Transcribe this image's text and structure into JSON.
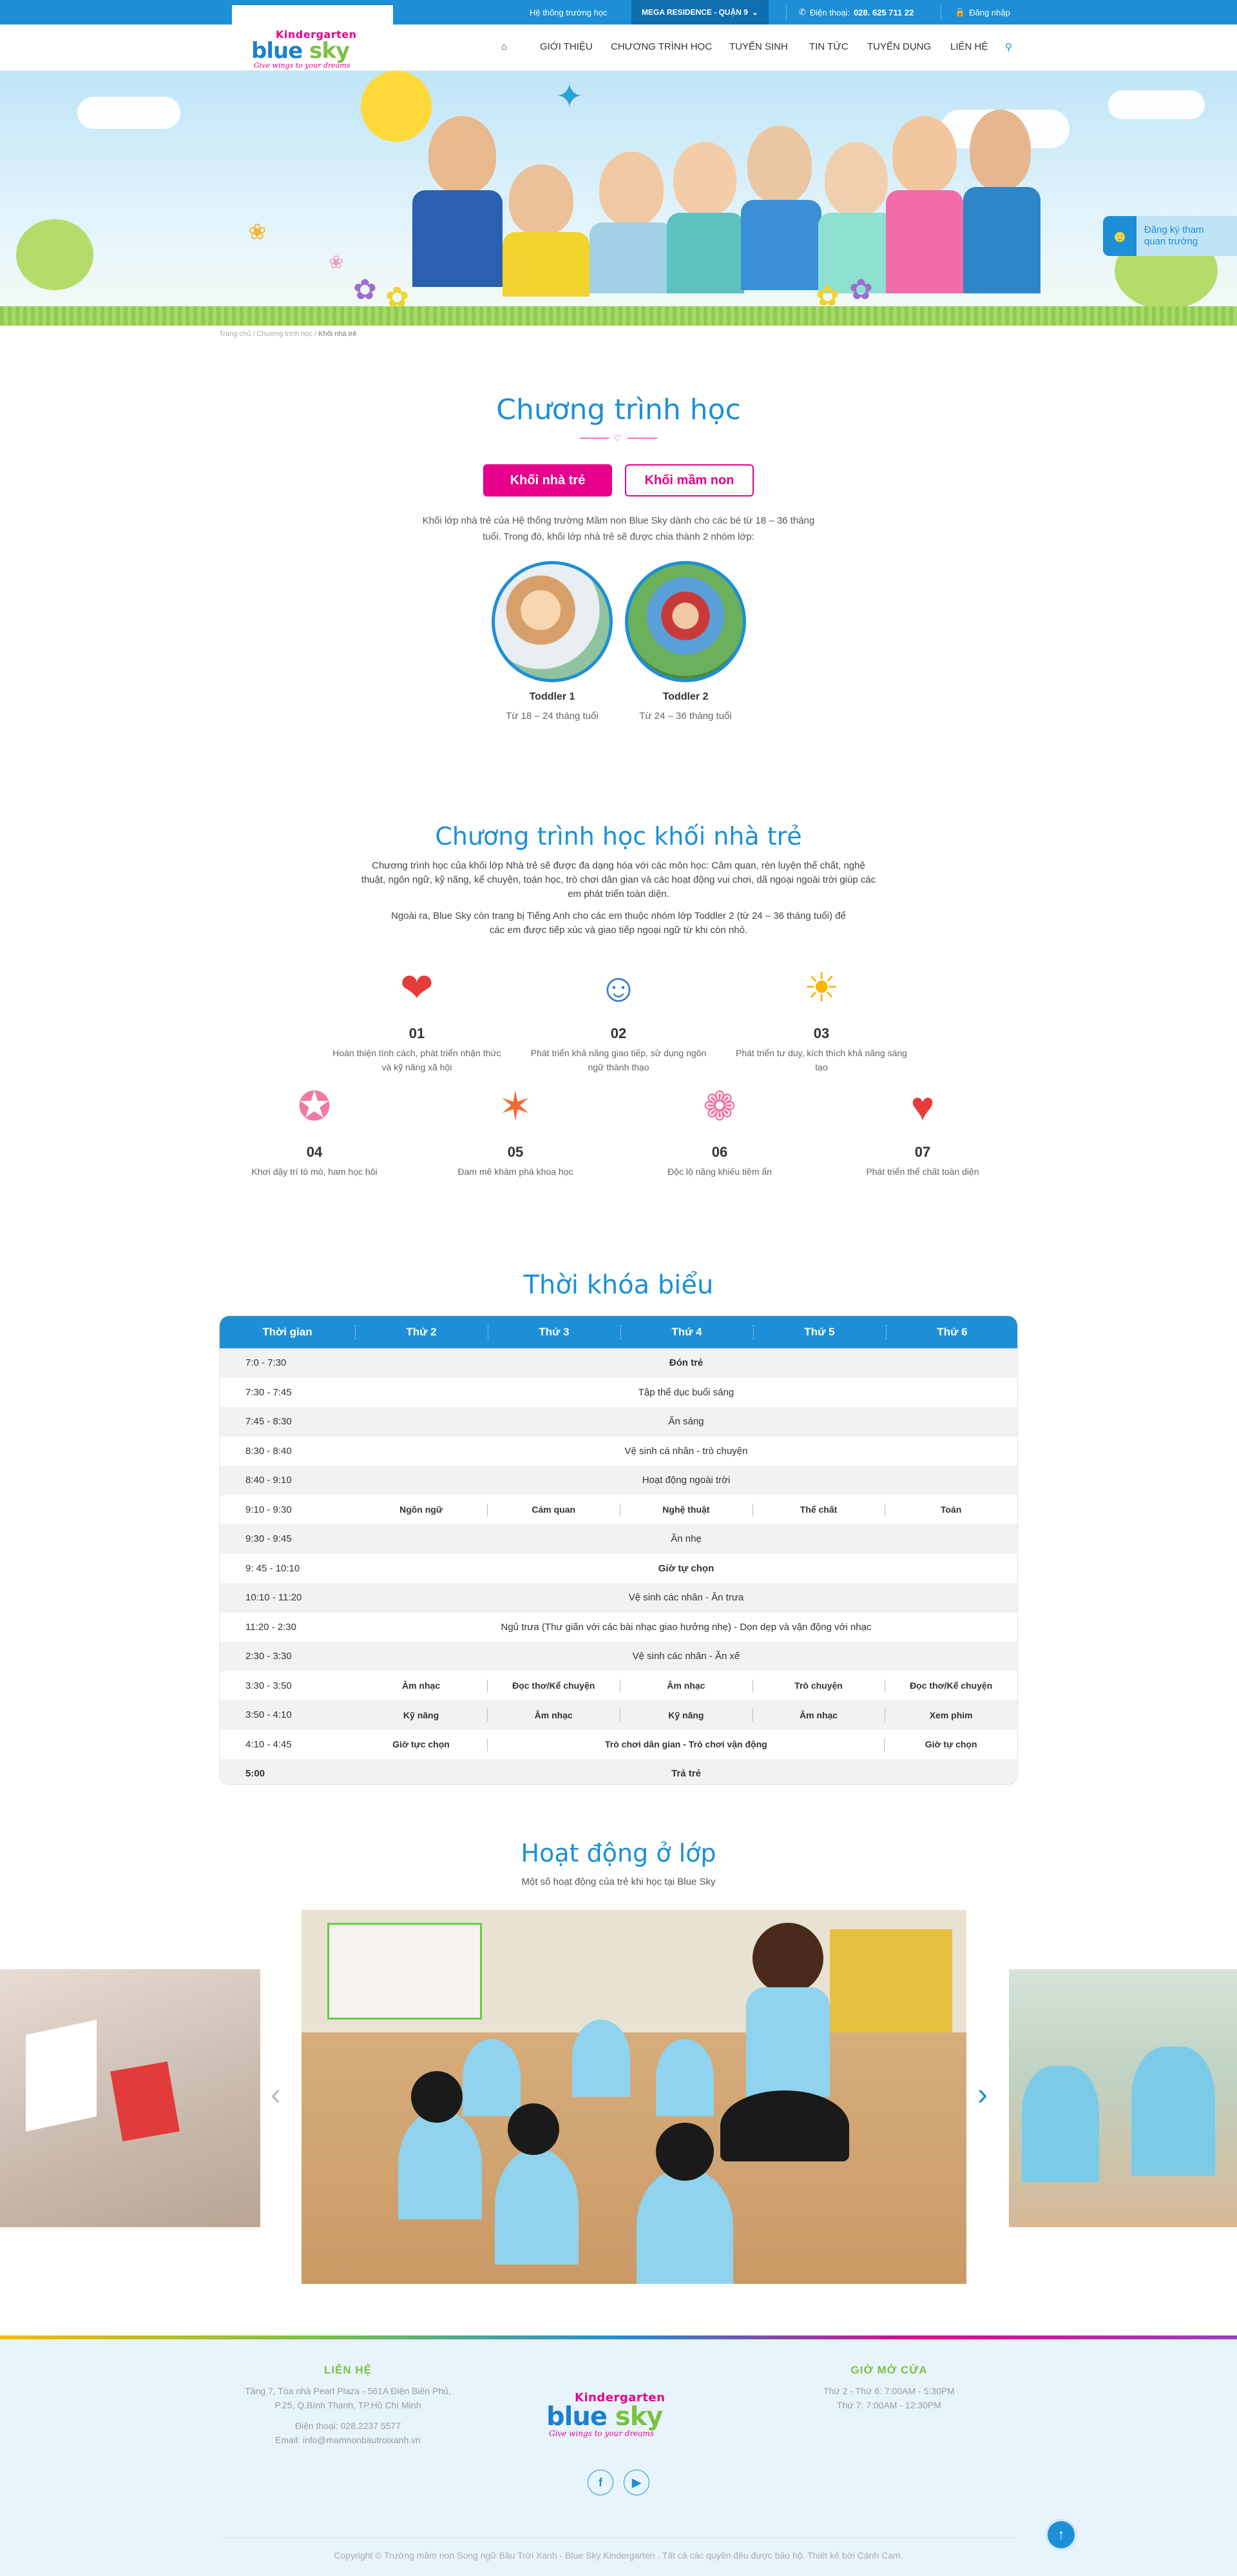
{
  "topbar": {
    "system_label": "Hệ thống trường học",
    "branch": "MEGA RESIDENCE - QUẬN 9",
    "phone_label": "Điện thoại:",
    "phone": "028. 625 711 22",
    "login": "Đăng nhập"
  },
  "logo": {
    "line1": "Kindergarten",
    "line2a": "blue",
    "line2b": "sky",
    "tagline": "Give wings to your dreams"
  },
  "nav": [
    "GIỚI THIỆU",
    "CHƯƠNG TRÌNH HỌC",
    "TUYỂN SINH",
    "TIN TỨC",
    "TUYỂN DỤNG",
    "LIÊN HỆ"
  ],
  "side_cta": {
    "line1": "Đăng ký tham",
    "line2": "quan trường"
  },
  "breadcrumb": {
    "home": "Trang chủ",
    "sep": "/",
    "parent": "Chương trình học",
    "current": "Khối nhà trẻ"
  },
  "program": {
    "title": "Chương trình học",
    "tabs": [
      "Khối nhà trẻ",
      "Khối mầm non"
    ],
    "intro": "Khối lớp nhà trẻ của Hệ thống trường Mầm non Blue Sky dành cho các bé từ 18 – 36 tháng tuổi. Trong đó, khối lớp nhà trẻ sẽ được chia thành 2 nhóm lớp:",
    "groups": [
      {
        "name": "Toddler 1",
        "age": "Từ 18 – 24 tháng tuổi"
      },
      {
        "name": "Toddler 2",
        "age": "Từ 24 – 36 tháng tuổi"
      }
    ]
  },
  "curriculum": {
    "title": "Chương trình học khối nhà trẻ",
    "p1": "Chương trình học của khối lớp Nhà trẻ sẽ được đa dạng hóa với các môn học: Cảm quan, rèn luyện thể chất, nghệ thuật, ngôn ngữ, kỹ năng, kể chuyện, toán học, trò chơi dân gian và các hoạt động vui chơi, dã ngoại ngoài trời giúp các em phát triển toàn diện.",
    "p2": "Ngoài ra, Blue Sky còn trang bị Tiếng Anh cho các em thuộc nhóm lớp Toddler 2 (từ 24 – 36 tháng tuổi) để các em được tiếp xúc và giao tiếp ngoại ngữ từ khi còn nhỏ.",
    "features": [
      {
        "num": "01",
        "text": "Hoàn thiện tính cách, phát triển nhận thức và kỹ năng xã hội",
        "icon": "heart-hands-icon"
      },
      {
        "num": "02",
        "text": "Phát triển khả năng giao tiếp, sử dụng ngôn ngữ thành thạo",
        "icon": "people-talking-icon"
      },
      {
        "num": "03",
        "text": "Phát triển tư duy, kích thích khả năng sáng tạo",
        "icon": "lightbulb-idea-icon"
      },
      {
        "num": "04",
        "text": "Khơi dậy trí tò mò, ham học hỏi",
        "icon": "bulb-mind-icon"
      },
      {
        "num": "05",
        "text": "Đam mê khám phá khoa học",
        "icon": "molecule-icon"
      },
      {
        "num": "06",
        "text": "Độc lộ năng khiếu tiềm ẩn",
        "icon": "brain-icon"
      },
      {
        "num": "07",
        "text": "Phát triển thể chất toàn diện",
        "icon": "heartbeat-icon"
      }
    ]
  },
  "timetable": {
    "title": "Thời khóa biểu",
    "headers": [
      "Thời gian",
      "Thứ 2",
      "Thứ 3",
      "Thứ 4",
      "Thứ 5",
      "Thứ 6"
    ],
    "rows": [
      {
        "time": "7:0 - 7:30",
        "all": "Đón trẻ"
      },
      {
        "time": "7:30 - 7:45",
        "all": "Tập thể dục buổi sáng"
      },
      {
        "time": "7:45 - 8:30",
        "all": "Ăn sáng"
      },
      {
        "time": "8:30 - 8:40",
        "all": "Vệ sinh cá nhân - trò chuyện"
      },
      {
        "time": "8:40 - 9:10",
        "all": "Hoạt động ngoài trời"
      },
      {
        "time": "9:10 - 9:30",
        "days": [
          "Ngôn ngữ",
          "Cảm quan",
          "Nghệ thuật",
          "Thể chất",
          "Toán"
        ]
      },
      {
        "time": "9:30 - 9:45",
        "all": "Ăn nhẹ"
      },
      {
        "time": "9: 45 - 10:10",
        "all": "Giờ tự chọn"
      },
      {
        "time": "10:10 - 11:20",
        "all": "Vệ sinh các nhân - Ăn trưa"
      },
      {
        "time": "11:20 - 2:30",
        "all": "Ngủ trưa (Thư giãn với các bài nhạc giao hưởng nhẹ) - Dọn dẹp và vận động với nhạc"
      },
      {
        "time": "2:30 - 3:30",
        "all": "Vệ sinh các nhân - Ăn xế"
      },
      {
        "time": "3:30 - 3:50",
        "days": [
          "Âm nhạc",
          "Đọc thơ/Kể chuyện",
          "Âm nhạc",
          "Trò chuyện",
          "Đọc thơ/Kể chuyện"
        ]
      },
      {
        "time": "3:50 - 4:10",
        "days": [
          "Kỹ năng",
          "Âm nhạc",
          "Kỹ năng",
          "Âm nhạc",
          "Xem phim"
        ]
      },
      {
        "time": "4:10 - 4:45",
        "mon": "Giờ tực chọn",
        "mid": "Trò chơi dân gian - Trò chơi vận động",
        "fri": "Giờ tự chọn"
      },
      {
        "time": "5:00",
        "all": "Trả trẻ"
      }
    ]
  },
  "activities": {
    "title": "Hoạt động ở lớp",
    "subtitle": "Một số hoạt động của trẻ khi học tại Blue Sky"
  },
  "footer": {
    "contact_title": "LIÊN HỆ",
    "address1": "Tầng 7, Tòa nhà Pearl Plaza - 561A Điện Biên Phủ,",
    "address2": "P.25, Q.Bình Thạnh, TP.Hồ Chí Minh",
    "phone": "Điện thoại: 028.2237 5577",
    "email": "Email: info@mamnonbautroixanh.vn",
    "hours_title": "GIỜ MỞ CỬA",
    "hours1": "Thứ 2 - Thứ 6: 7:00AM - 5:30PM",
    "hours2": "Thứ 7: 7:00AM - 12:30PM",
    "copyright": "Copyright © Trường mầm non Song ngữ Bầu Trời Xanh - Blue Sky Kindergarten . Tất cả các quyền đều được bảo hộ. Thiết kế bởi Cánh Cam."
  },
  "colors": {
    "brand_blue": "#1d8fd6",
    "brand_pink": "#e6008b",
    "brand_green": "#7cc242"
  }
}
